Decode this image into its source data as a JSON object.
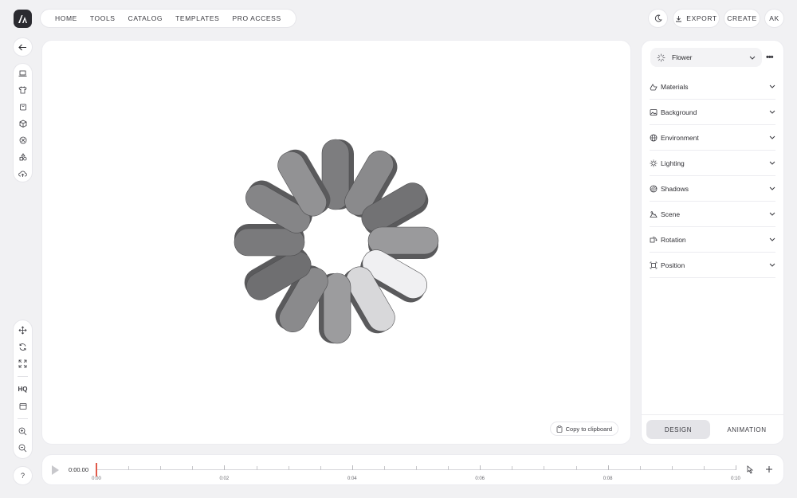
{
  "nav": {
    "items": [
      "HOME",
      "TOOLS",
      "CATALOG",
      "TEMPLATES",
      "PRO ACCESS"
    ],
    "export_label": "EXPORT",
    "create_label": "CREATE",
    "avatar_initials": "AK"
  },
  "canvas": {
    "copy_label": "Copy to clipboard"
  },
  "panel": {
    "preset_label": "Flower",
    "sections": [
      "Materials",
      "Background",
      "Environment",
      "Lighting",
      "Shadows",
      "Scene",
      "Rotation",
      "Position"
    ],
    "tabs": [
      "DESIGN",
      "ANIMATION"
    ],
    "active_tab": "DESIGN"
  },
  "left_toolbar": {
    "hq_label": "HQ",
    "help_label": "?"
  },
  "timeline": {
    "timecode": "0:00.00",
    "labels": [
      "0:00",
      "0:02",
      "0:04",
      "0:06",
      "0:08",
      "0:10"
    ]
  },
  "colors": {
    "background": "#f1f1f3",
    "surface": "#ffffff",
    "playhead": "#e05a4a",
    "logo": "#2b2b30"
  }
}
